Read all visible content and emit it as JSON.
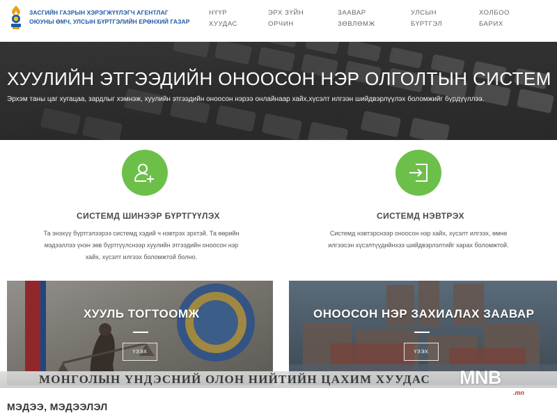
{
  "header": {
    "agency_line1": "ЗАСГИЙН ГАЗРЫН ХЭРЭГЖҮҮЛЭГЧ АГЕНТЛАГ",
    "agency_line2": "ОЮУНЫ ӨМЧ, УЛСЫН БҮРТГЭЛИЙН ЕРӨНХИЙ ГАЗАР",
    "nav": [
      {
        "line1": "НҮҮР",
        "line2": "ХУУДАС"
      },
      {
        "line1": "ЭРХ ЗҮЙН",
        "line2": "ОРЧИН"
      },
      {
        "line1": "ЗААВАР",
        "line2": "ЗӨВЛӨМЖ"
      },
      {
        "line1": "УЛСЫН",
        "line2": "БҮРТГЭЛ"
      },
      {
        "line1": "ХОЛБОО",
        "line2": "БАРИХ"
      }
    ]
  },
  "hero": {
    "title": "ХУУЛИЙН ЭТГЭЭДИЙН ОНООСОН НЭР ОЛГОЛТЫН СИСТЕМ",
    "subtitle": "Эрхэм таны цаг хугацаа, зардлыг хэмнэж, хуулийн этгээдийн оноосон нэрээ онлайнаар хайх,хүсэлт илгээн шийдвэрлүүлэх боломжийг бүрдүүллээ."
  },
  "services": [
    {
      "icon": "add-user-icon",
      "title": "СИСТЕМД ШИНЭЭР БҮРТГҮҮЛЭХ",
      "desc": [
        "Та энэхүү бүртгэлээрээ системд хэдий ч нэвтрэх эрхтэй. Та өөрийн",
        "мэдээллээ үнэн зөв бүртгүүлснээр хуулийн этгээдийн оноосон нэр",
        "хайх, хүсэлт илгээх боломжтой болно."
      ]
    },
    {
      "icon": "login-icon",
      "title": "СИСТЕМД НЭВТРЭХ",
      "desc": [
        "Системд нэвтэрснээр оноосон нэр хайх, хүсэлт илгээх, өмнө",
        "илгээсэн хүсэлтүүдийнхээ шийдвэрлэлтийг харах боломжтой."
      ]
    }
  ],
  "banners": [
    {
      "title": "ХУУЛЬ ТОГТООМЖ",
      "button": "ҮЗЭХ"
    },
    {
      "title": "ОНООСОН НЭР ЗАХИАЛАХ ЗААВАР",
      "button": "ҮЗЭХ"
    }
  ],
  "tv_overlay": {
    "text": "МОНГОЛЫН ҮНДЭСНИЙ ОЛОН НИЙТИЙН ЦАХИМ ХУУДАС",
    "logo": "MNB",
    "logo_domain": ".mn"
  },
  "news": {
    "heading": "МЭДЭЭ, МЭДЭЭЛЭЛ"
  },
  "colors": {
    "accent_green": "#6cc04a",
    "agency_blue": "#1e5aa8",
    "mnb_red": "#c0392b"
  }
}
